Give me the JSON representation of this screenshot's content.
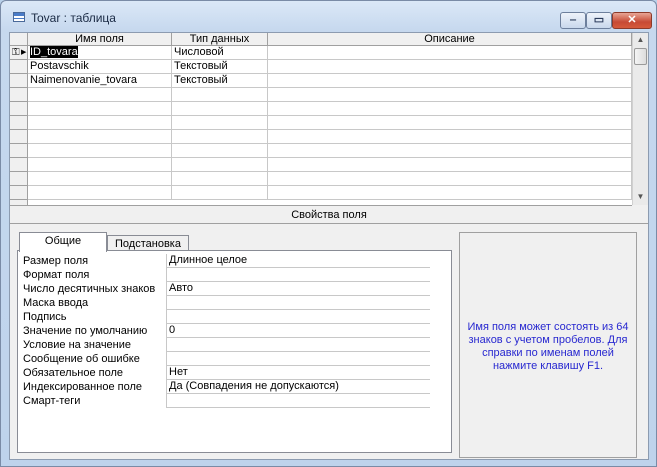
{
  "window": {
    "title": "Tovar : таблица"
  },
  "grid": {
    "columns": [
      "Имя поля",
      "Тип данных",
      "Описание"
    ],
    "rows": [
      {
        "name": "ID_tovara",
        "type": "Числовой",
        "description": ""
      },
      {
        "name": "Postavschik",
        "type": "Текстовый",
        "description": ""
      },
      {
        "name": "Naimenovanie_tovara",
        "type": "Текстовый",
        "description": ""
      }
    ]
  },
  "properties": {
    "section_title": "Свойства поля",
    "tabs": [
      "Общие",
      "Подстановка"
    ],
    "items": [
      {
        "label": "Размер поля",
        "value": "Длинное целое"
      },
      {
        "label": "Формат поля",
        "value": ""
      },
      {
        "label": "Число десятичных знаков",
        "value": "Авто"
      },
      {
        "label": "Маска ввода",
        "value": ""
      },
      {
        "label": "Подпись",
        "value": ""
      },
      {
        "label": "Значение по умолчанию",
        "value": "0"
      },
      {
        "label": "Условие на значение",
        "value": ""
      },
      {
        "label": "Сообщение об ошибке",
        "value": ""
      },
      {
        "label": "Обязательное поле",
        "value": "Нет"
      },
      {
        "label": "Индексированное поле",
        "value": "Да (Совпадения не допускаются)"
      },
      {
        "label": "Смарт-теги",
        "value": ""
      }
    ]
  },
  "help": {
    "text": "Имя поля может состоять из 64 знаков с учетом пробелов.  Для справки по именам полей нажмите клавишу F1."
  },
  "colors": {
    "help_text": "#2828d0",
    "close_button": "#c74a34",
    "selection": "#000000"
  }
}
